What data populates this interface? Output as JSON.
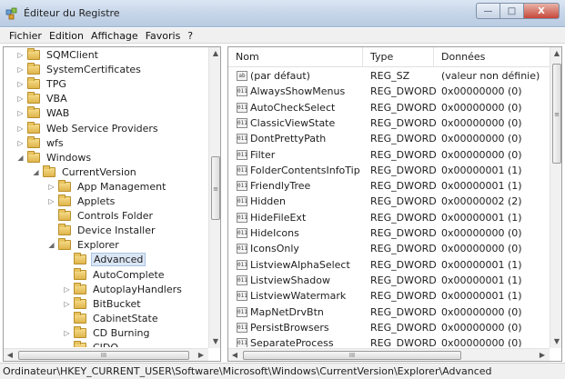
{
  "window": {
    "title": "Éditeur du Registre"
  },
  "menu": {
    "items": [
      "Fichier",
      "Edition",
      "Affichage",
      "Favoris",
      "?"
    ]
  },
  "tree": {
    "items": [
      {
        "label": "SQMClient",
        "indent": 0,
        "expander": "▷"
      },
      {
        "label": "SystemCertificates",
        "indent": 0,
        "expander": "▷"
      },
      {
        "label": "TPG",
        "indent": 0,
        "expander": "▷"
      },
      {
        "label": "VBA",
        "indent": 0,
        "expander": "▷"
      },
      {
        "label": "WAB",
        "indent": 0,
        "expander": "▷"
      },
      {
        "label": "Web Service Providers",
        "indent": 0,
        "expander": "▷"
      },
      {
        "label": "wfs",
        "indent": 0,
        "expander": "▷"
      },
      {
        "label": "Windows",
        "indent": 0,
        "expander": "◢"
      },
      {
        "label": "CurrentVersion",
        "indent": 1,
        "expander": "◢"
      },
      {
        "label": "App Management",
        "indent": 2,
        "expander": "▷"
      },
      {
        "label": "Applets",
        "indent": 2,
        "expander": "▷"
      },
      {
        "label": "Controls Folder",
        "indent": 2,
        "expander": ""
      },
      {
        "label": "Device Installer",
        "indent": 2,
        "expander": ""
      },
      {
        "label": "Explorer",
        "indent": 2,
        "expander": "◢"
      },
      {
        "label": "Advanced",
        "indent": 3,
        "expander": "",
        "selected": true
      },
      {
        "label": "AutoComplete",
        "indent": 3,
        "expander": ""
      },
      {
        "label": "AutoplayHandlers",
        "indent": 3,
        "expander": "▷"
      },
      {
        "label": "BitBucket",
        "indent": 3,
        "expander": "▷"
      },
      {
        "label": "CabinetState",
        "indent": 3,
        "expander": ""
      },
      {
        "label": "CD Burning",
        "indent": 3,
        "expander": "▷"
      },
      {
        "label": "CIDO",
        "indent": 3,
        "expander": ""
      }
    ]
  },
  "values": {
    "columns": {
      "name": "Nom",
      "type": "Type",
      "data": "Données"
    },
    "rows": [
      {
        "name": "(par défaut)",
        "type": "REG_SZ",
        "data": "(valeur non définie)",
        "icon": "ab"
      },
      {
        "name": "AlwaysShowMenus",
        "type": "REG_DWORD",
        "data": "0x00000000 (0)",
        "icon": "011"
      },
      {
        "name": "AutoCheckSelect",
        "type": "REG_DWORD",
        "data": "0x00000000 (0)",
        "icon": "011"
      },
      {
        "name": "ClassicViewState",
        "type": "REG_DWORD",
        "data": "0x00000000 (0)",
        "icon": "011"
      },
      {
        "name": "DontPrettyPath",
        "type": "REG_DWORD",
        "data": "0x00000000 (0)",
        "icon": "011"
      },
      {
        "name": "Filter",
        "type": "REG_DWORD",
        "data": "0x00000000 (0)",
        "icon": "011"
      },
      {
        "name": "FolderContentsInfoTip",
        "type": "REG_DWORD",
        "data": "0x00000001 (1)",
        "icon": "011"
      },
      {
        "name": "FriendlyTree",
        "type": "REG_DWORD",
        "data": "0x00000001 (1)",
        "icon": "011"
      },
      {
        "name": "Hidden",
        "type": "REG_DWORD",
        "data": "0x00000002 (2)",
        "icon": "011"
      },
      {
        "name": "HideFileExt",
        "type": "REG_DWORD",
        "data": "0x00000001 (1)",
        "icon": "011"
      },
      {
        "name": "HideIcons",
        "type": "REG_DWORD",
        "data": "0x00000000 (0)",
        "icon": "011"
      },
      {
        "name": "IconsOnly",
        "type": "REG_DWORD",
        "data": "0x00000000 (0)",
        "icon": "011"
      },
      {
        "name": "ListviewAlphaSelect",
        "type": "REG_DWORD",
        "data": "0x00000001 (1)",
        "icon": "011"
      },
      {
        "name": "ListviewShadow",
        "type": "REG_DWORD",
        "data": "0x00000001 (1)",
        "icon": "011"
      },
      {
        "name": "ListviewWatermark",
        "type": "REG_DWORD",
        "data": "0x00000001 (1)",
        "icon": "011"
      },
      {
        "name": "MapNetDrvBtn",
        "type": "REG_DWORD",
        "data": "0x00000000 (0)",
        "icon": "011"
      },
      {
        "name": "PersistBrowsers",
        "type": "REG_DWORD",
        "data": "0x00000000 (0)",
        "icon": "011"
      },
      {
        "name": "SeparateProcess",
        "type": "REG_DWORD",
        "data": "0x00000000 (0)",
        "icon": "011"
      }
    ]
  },
  "scroll": {
    "up_arrow": "▲",
    "down_arrow": "▼",
    "left_arrow": "◀",
    "right_arrow": "▶",
    "thumb_grip": "III",
    "side_grip": "≡"
  },
  "window_buttons": {
    "minimize": "—",
    "maximize": "□",
    "close": "X"
  },
  "statusbar": {
    "path": "Ordinateur\\HKEY_CURRENT_USER\\Software\\Microsoft\\Windows\\CurrentVersion\\Explorer\\Advanced"
  }
}
